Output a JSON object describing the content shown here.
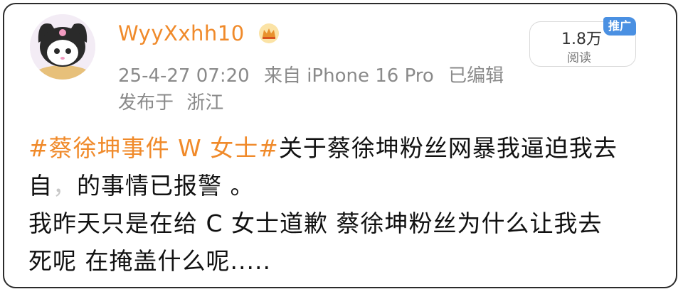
{
  "post": {
    "username": "WyyXxhh10",
    "timestamp": "25-4-27 07:20",
    "source": "来自 iPhone 16 Pro",
    "edited": "已编辑",
    "location_prefix": "发布于",
    "location": "浙江",
    "reads": {
      "count": "1.8万",
      "label": "阅读",
      "promo_badge": "推广"
    },
    "content": {
      "topic": "#蔡徐坤事件 W 女士#",
      "line1_rest": "关于蔡徐坤粉丝网暴我逼迫我去",
      "line2_start": "自",
      "line2_redacted": "，",
      "line2_rest": "的事情已报警 。",
      "line3": "我昨天只是在给 C 女士道歉 蔡徐坤粉丝为什么让我去",
      "line4": "死呢 在掩盖什么呢....."
    },
    "icons": {
      "avatar": "kuromi-avatar",
      "crown": "crown-icon"
    },
    "colors": {
      "username": "#f08a2a",
      "topic": "#f08a2a",
      "meta": "#8a8a8a",
      "promo_badge": "#4a90e2"
    }
  }
}
